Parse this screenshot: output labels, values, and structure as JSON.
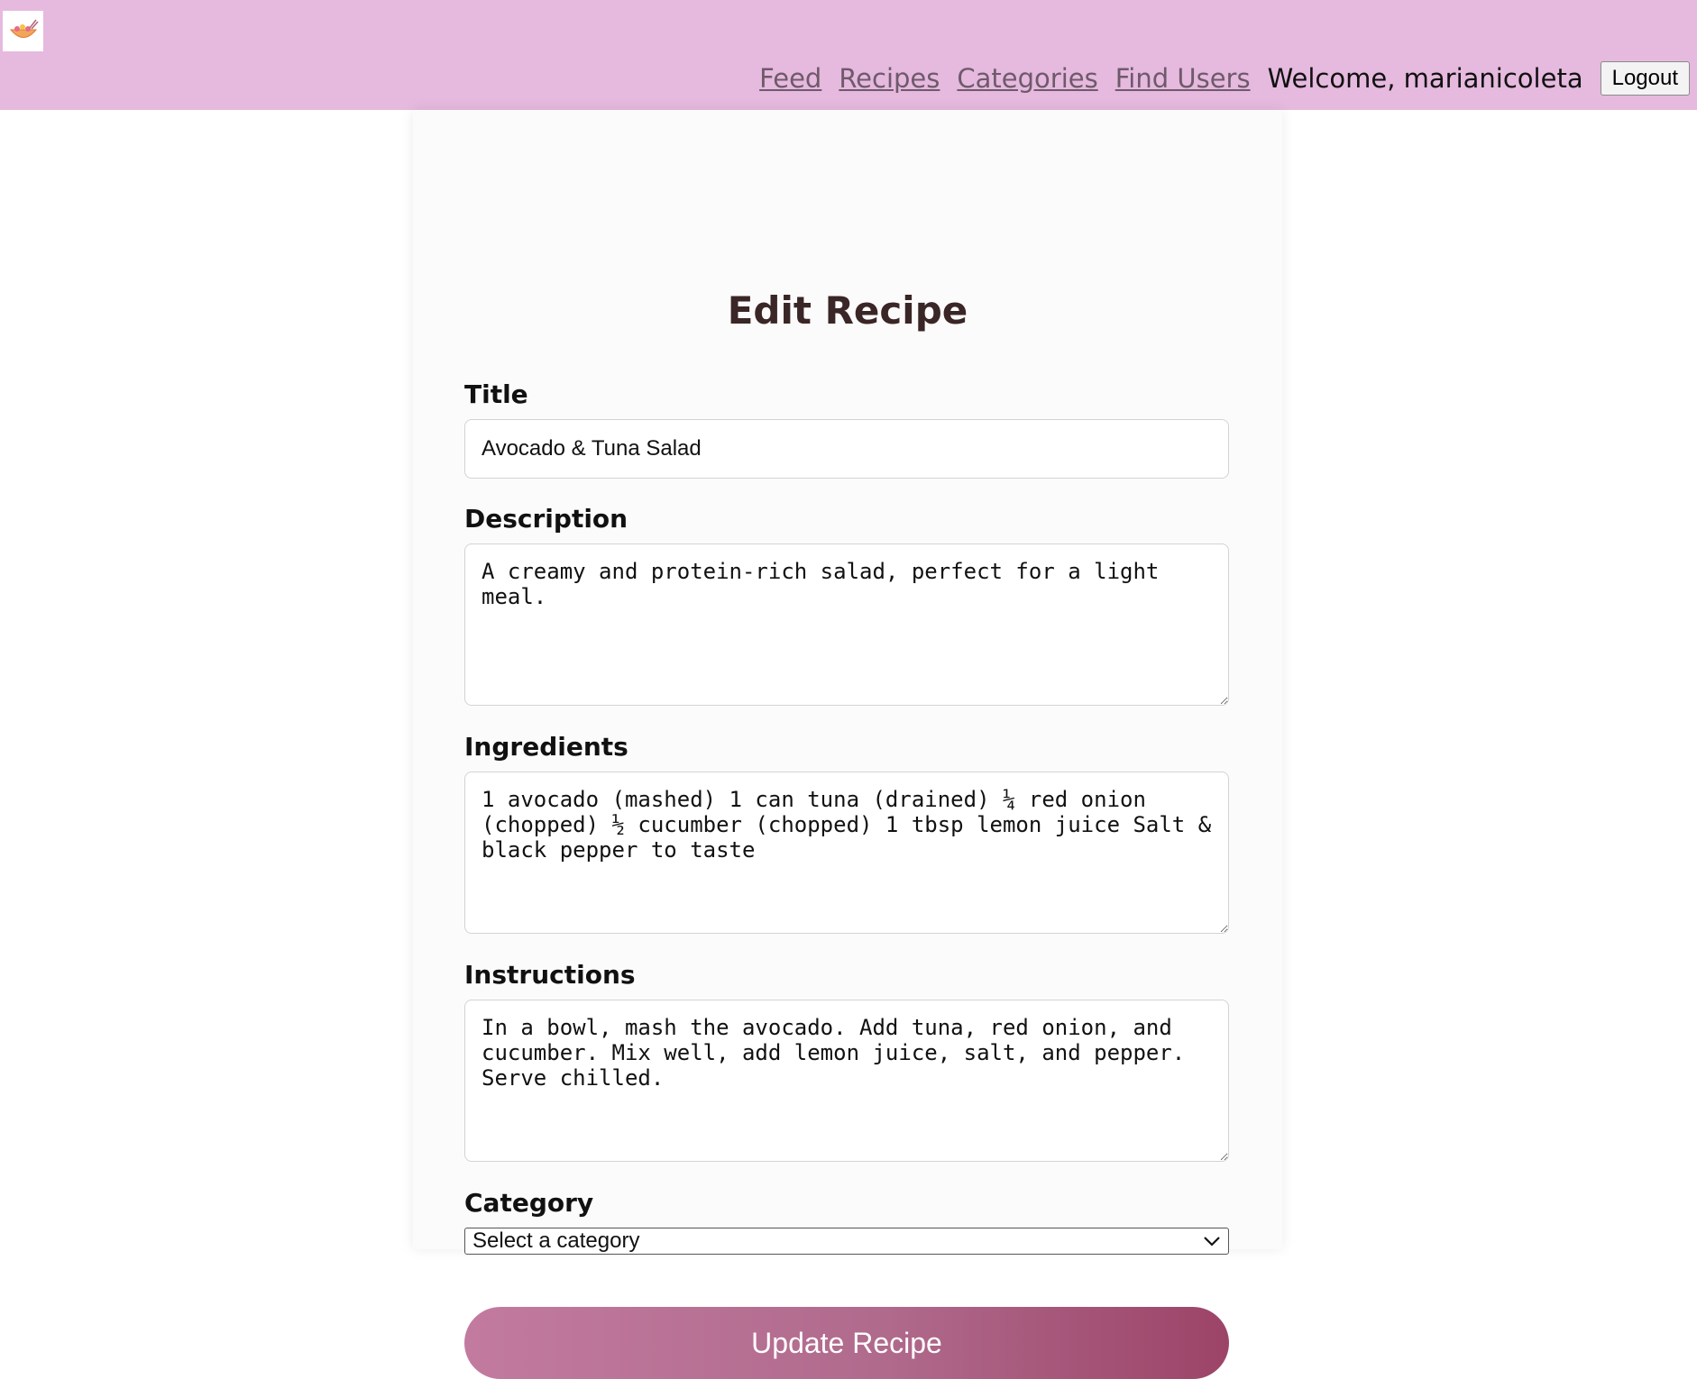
{
  "nav": {
    "links": [
      "Feed",
      "Recipes",
      "Categories",
      "Find Users"
    ],
    "welcome": "Welcome, marianicoleta",
    "logout_label": "Logout"
  },
  "form": {
    "heading": "Edit Recipe",
    "title_label": "Title",
    "title_value": "Avocado & Tuna Salad",
    "description_label": "Description",
    "description_value": "A creamy and protein-rich salad, perfect for a light meal.",
    "ingredients_label": "Ingredients",
    "ingredients_value": "1 avocado (mashed) 1 can tuna (drained) ¼ red onion (chopped) ½ cucumber (chopped) 1 tbsp lemon juice Salt & black pepper to taste",
    "instructions_label": "Instructions",
    "instructions_value": "In a bowl, mash the avocado. Add tuna, red onion, and cucumber. Mix well, add lemon juice, salt, and pepper. Serve chilled.",
    "category_label": "Category",
    "category_selected": "Select a category",
    "submit_label": "Update Recipe"
  },
  "colors": {
    "navbar_bg": "#e6b9de",
    "heading_color": "#3a2626",
    "button_gradient_start": "#c27b9f",
    "button_gradient_end": "#9c4468"
  },
  "icons": {
    "logo": "salad-bowl-logo-icon",
    "select_arrow": "chevron-down-icon"
  }
}
